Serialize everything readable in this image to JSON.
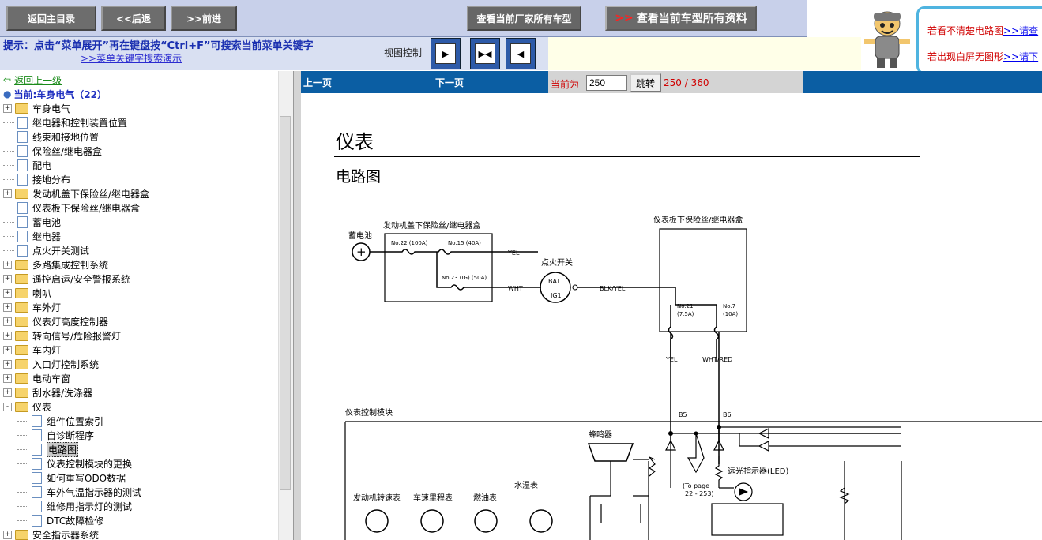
{
  "toolbar": {
    "home": "返回主目录",
    "back": "<<后退",
    "forward": ">>前进",
    "view_models": "查看当前厂家所有车型",
    "view_all_arrow": ">>",
    "view_all": "查看当前车型所有资料"
  },
  "hint": {
    "text": "提示：点击“菜单展开”再在键盘按“Ctrl+F”可搜索当前菜单关键字",
    "link": ">>菜单关键字搜索演示",
    "view_control": "视图控制"
  },
  "right_panel": {
    "line1_text": "若看不清楚电路图",
    "line1_link": ">>请查",
    "line2_text": "若出现白屏无图形",
    "line2_link": ">>请下"
  },
  "tree": {
    "back_up": "返回上一级",
    "current": "当前:车身电气（22）",
    "items": [
      {
        "label": "车身电气",
        "type": "folder",
        "exp": "+"
      },
      {
        "label": "继电器和控制装置位置",
        "type": "doc"
      },
      {
        "label": "线束和接地位置",
        "type": "doc"
      },
      {
        "label": "保险丝/继电器盒",
        "type": "doc"
      },
      {
        "label": "配电",
        "type": "doc"
      },
      {
        "label": "接地分布",
        "type": "doc"
      },
      {
        "label": "发动机盖下保险丝/继电器盒",
        "type": "folder",
        "exp": "+"
      },
      {
        "label": "仪表板下保险丝/继电器盒",
        "type": "doc"
      },
      {
        "label": "蓄电池",
        "type": "doc"
      },
      {
        "label": "继电器",
        "type": "doc"
      },
      {
        "label": "点火开关测试",
        "type": "doc"
      },
      {
        "label": "多路集成控制系统",
        "type": "folder",
        "exp": "+"
      },
      {
        "label": "遥控启运/安全警报系统",
        "type": "folder",
        "exp": "+"
      },
      {
        "label": "喇叭",
        "type": "folder",
        "exp": "+"
      },
      {
        "label": "车外灯",
        "type": "folder",
        "exp": "+"
      },
      {
        "label": "仪表灯高度控制器",
        "type": "folder",
        "exp": "+"
      },
      {
        "label": "转向信号/危险报警灯",
        "type": "folder",
        "exp": "+"
      },
      {
        "label": "车内灯",
        "type": "folder",
        "exp": "+"
      },
      {
        "label": "入口灯控制系统",
        "type": "folder",
        "exp": "+"
      },
      {
        "label": "电动车窗",
        "type": "folder",
        "exp": "+"
      },
      {
        "label": "刮水器/洗涤器",
        "type": "folder",
        "exp": "+"
      },
      {
        "label": "仪表",
        "type": "folder",
        "exp": "-"
      },
      {
        "label": "组件位置索引",
        "type": "subdoc"
      },
      {
        "label": "自诊断程序",
        "type": "subdoc"
      },
      {
        "label": "电路图",
        "type": "subdoc",
        "selected": true
      },
      {
        "label": "仪表控制模块的更换",
        "type": "subdoc"
      },
      {
        "label": "如何重写ODO数据",
        "type": "subdoc"
      },
      {
        "label": "车外气温指示器的测试",
        "type": "subdoc"
      },
      {
        "label": "维修用指示灯的测试",
        "type": "subdoc"
      },
      {
        "label": "DTC故障检修",
        "type": "subdoc"
      },
      {
        "label": "安全指示器系统",
        "type": "folder",
        "exp": "+"
      }
    ]
  },
  "pager": {
    "prev": "上一页",
    "next": "下一页",
    "current_label": "当前为",
    "current_value": "250",
    "jump": "跳转",
    "info": "250 / 360"
  },
  "document": {
    "title": "仪表",
    "subtitle": "电路图",
    "labels": {
      "battery": "蓄电池",
      "engine_box": "发动机盖下保险丝/继电器盒",
      "dash_box": "仪表板下保险丝/继电器盒",
      "ignition": "点火开关",
      "fuse22": "No.22 (100A)",
      "fuse15": "No.15 (40A)",
      "fuse23": "No.23 (IG) (50A)",
      "fuse21": "No.21",
      "fuse21b": "(7.5A)",
      "fuse7": "No.7",
      "fuse7b": "(10A)",
      "yel": "YEL",
      "wht": "WHT",
      "blk_yel": "BLK/YEL",
      "yel2": "YEL",
      "wht_red": "WHT/RED",
      "bat": "BAT",
      "ig1": "IG1",
      "module": "仪表控制模块",
      "b5": "B5",
      "b6": "B6",
      "buzzer": "蜂鸣器",
      "high_beam": "远光指示器(LED)",
      "to_page": "(To page",
      "to_page2": "22 - 253)",
      "water_temp": "水温表",
      "tach": "发动机转速表",
      "speedo": "车速里程表",
      "fuel": "燃油表"
    }
  }
}
